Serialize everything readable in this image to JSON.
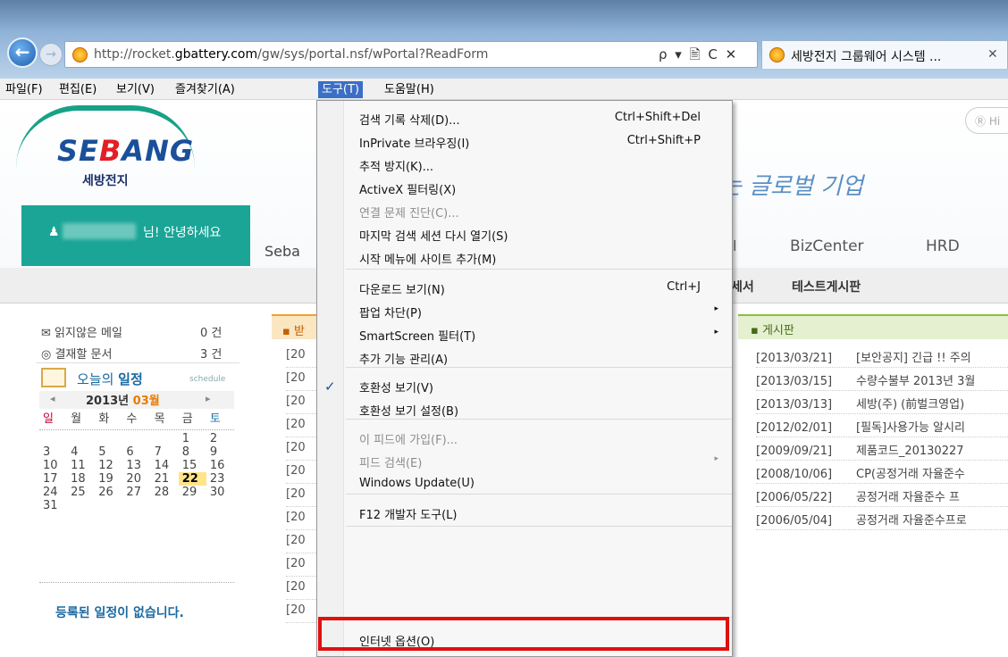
{
  "browser": {
    "url_prefix": "http://rocket.",
    "url_domain": "gbattery.com",
    "url_suffix": "/gw/sys/portal.nsf/wPortal?ReadForm",
    "addr_icons": "ρ ▾ 🖹 C ✕",
    "tab_title": "세방전지 그룹웨어 시스템 ...",
    "tab_close": "✕",
    "back": "←",
    "forward": "→"
  },
  "menubar": [
    "파일(F)",
    "편집(E)",
    "보기(V)",
    "즐겨찾기(A)",
    "도구(T)",
    "도움말(H)"
  ],
  "site": {
    "logo_a": "SE",
    "logo_b": "B",
    "logo_c": "ANG",
    "logo_kr": "세방전지",
    "greeting": "님! 안녕하세요",
    "nav_seba": "Seba",
    "slogan": "는 글로벌 기업",
    "nav_l": "l",
    "nav_biz": "BizCenter",
    "nav_hrd": "HRD",
    "login": "Ⓡ Hi",
    "sub_a": "세서",
    "sub_b": "테스트게시판"
  },
  "left": {
    "mail_label": "✉ 읽지않은 메일",
    "mail_count": "0 건",
    "approve_label": "◎ 결재할  문서",
    "approve_count": "3 건",
    "cal_title_a": "오늘의 ",
    "cal_title_b": "일정",
    "cal_small": "schedule",
    "cal_year": "2013년 ",
    "cal_month": "03월",
    "dow": [
      "일",
      "월",
      "화",
      "수",
      "목",
      "금",
      "토"
    ],
    "days": [
      "",
      "",
      "",
      "",
      "",
      "1",
      "2",
      "3",
      "4",
      "5",
      "6",
      "7",
      "8",
      "9",
      "10",
      "11",
      "12",
      "13",
      "14",
      "15",
      "16",
      "17",
      "18",
      "19",
      "20",
      "21",
      "22",
      "23",
      "24",
      "25",
      "26",
      "27",
      "28",
      "29",
      "30",
      "31"
    ],
    "today": "22",
    "no_schedule": "등록된 일정이 없습니다."
  },
  "center": {
    "head": "▪ 받",
    "items": [
      "[20",
      "[20",
      "[20",
      "[20",
      "[20",
      "[20",
      "[20",
      "[20",
      "[20",
      "[20",
      "[20",
      "[20"
    ]
  },
  "board": {
    "head": "▪ 게시판",
    "items": [
      {
        "date": "[2013/03/21]",
        "title": "[보안공지] 긴급 !! 주의"
      },
      {
        "date": "[2013/03/15]",
        "title": "수량수불부 2013년 3월"
      },
      {
        "date": "[2013/03/13]",
        "title": "세방(주) (前벌크영업)"
      },
      {
        "date": "[2012/02/01]",
        "title": "[필독]사용가능 알시리"
      },
      {
        "date": "[2009/09/21]",
        "title": "제품코드_20130227"
      },
      {
        "date": "[2008/10/06]",
        "title": "CP(공정거래 자율준수"
      },
      {
        "date": "[2006/05/22]",
        "title": "공정거래 자율준수 프"
      },
      {
        "date": "[2006/05/04]",
        "title": "공정거래 자율준수프로"
      }
    ]
  },
  "tools_menu": [
    {
      "label": "검색 기록 삭제(D)...",
      "shortcut": "Ctrl+Shift+Del"
    },
    {
      "label": "InPrivate 브라우징(I)",
      "shortcut": "Ctrl+Shift+P"
    },
    {
      "label": "추적 방지(K)...",
      "shortcut": ""
    },
    {
      "label": "ActiveX 필터링(X)",
      "shortcut": ""
    },
    {
      "label": "연결 문제 진단(C)...",
      "shortcut": ""
    },
    {
      "label": "마지막 검색 세션 다시 열기(S)",
      "shortcut": ""
    },
    {
      "label": "시작 메뉴에 사이트 추가(M)",
      "shortcut": ""
    },
    {
      "label": "다운로드 보기(N)",
      "shortcut": "Ctrl+J"
    },
    {
      "label": "팝업 차단(P)",
      "shortcut": ""
    },
    {
      "label": "SmartScreen 필터(T)",
      "shortcut": ""
    },
    {
      "label": "추가 기능 관리(A)",
      "shortcut": ""
    },
    {
      "label": "호환성 보기(V)",
      "shortcut": ""
    },
    {
      "label": "호환성 보기 설정(B)",
      "shortcut": ""
    },
    {
      "label": "이 피드에 가입(F)...",
      "shortcut": ""
    },
    {
      "label": "피드 검색(E)",
      "shortcut": ""
    },
    {
      "label": "Windows Update(U)",
      "shortcut": ""
    },
    {
      "label": "F12 개발자 도구(L)",
      "shortcut": ""
    },
    {
      "label": "인터넷 옵션(O)",
      "shortcut": ""
    }
  ],
  "submenu_arrow": "▸",
  "check_mark": "✓",
  "colors": {
    "accent": "#3b6fc6",
    "highlight_box": "#e01010",
    "brand_teal": "#1aa596",
    "brand_blue": "#1a4f9a"
  }
}
